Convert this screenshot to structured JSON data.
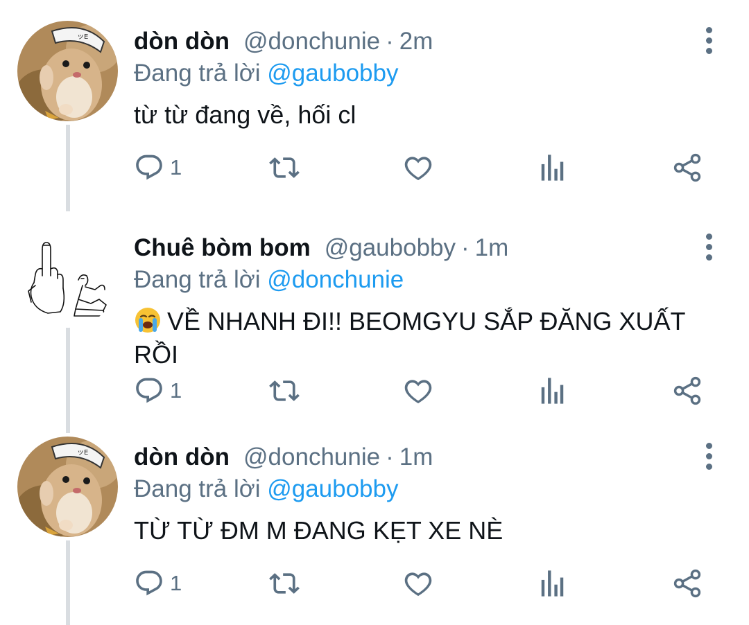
{
  "tweets": [
    {
      "author_name": "dòn dòn",
      "handle": "@donchunie",
      "separator": "·",
      "time": "2m",
      "reply_prefix": "Đang trả lời",
      "reply_to": "@gaubobby",
      "text": "từ từ đang về, hối cl",
      "reply_count": "1",
      "avatar": "hamster-avatar"
    },
    {
      "author_name": "Chuê bòm bom",
      "handle": "@gaubobby",
      "separator": "·",
      "time": "1m",
      "reply_prefix": "Đang trả lời",
      "reply_to": "@donchunie",
      "text": "VỀ NHANH ĐI!! BEOMGYU SẮP ĐĂNG XUẤT RỒI",
      "reply_count": "1",
      "avatar": "middle-finger-sketch-avatar",
      "leading_emoji": "loudly-crying-face"
    },
    {
      "author_name": "dòn dòn",
      "handle": "@donchunie",
      "separator": "·",
      "time": "1m",
      "reply_prefix": "Đang trả lời",
      "reply_to": "@gaubobby",
      "text": "TỪ TỪ ĐM M ĐANG KẸT XE NÈ",
      "reply_count": "1",
      "avatar": "hamster-avatar"
    }
  ],
  "icons": {
    "reply": "reply-icon",
    "retweet": "retweet-icon",
    "like": "heart-icon",
    "analytics": "analytics-icon",
    "share": "share-icon",
    "more": "more-icon"
  },
  "colors": {
    "text": "#0f1419",
    "secondary": "#5b7083",
    "mention": "#1d9bf0",
    "thread_line": "#d9dde1"
  }
}
